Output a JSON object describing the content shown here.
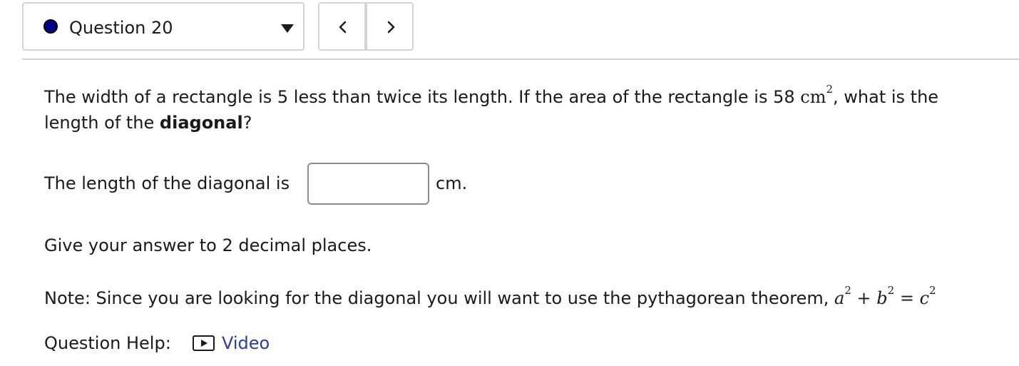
{
  "question_selector": {
    "label": "Question 20",
    "status_color": "#00008b"
  },
  "nav": {
    "prev_icon": "chevron-left-icon",
    "next_icon": "chevron-right-icon"
  },
  "question": {
    "text_part1": "The width of a rectangle is 5 less than twice its length. If the area of the rectangle is 58 ",
    "area_unit": "cm",
    "area_exponent": "2",
    "text_part2": ", what is the",
    "line2_prefix": "length of the ",
    "line2_bold": "diagonal",
    "line2_suffix": "?"
  },
  "answer": {
    "prompt": "The length of the diagonal is",
    "value": "",
    "units": "cm."
  },
  "instructions": "Give your answer to 2 decimal places.",
  "note": {
    "text": "Note: Since you are looking for the diagonal you will want to use the pythagorean theorem, ",
    "formula": {
      "a": "a",
      "b": "b",
      "c": "c",
      "exp": "2",
      "plus": "+",
      "equals": "="
    }
  },
  "help": {
    "label": "Question Help:",
    "link_label": "Video",
    "link_icon": "play-icon",
    "link_color": "#2f3a9e"
  }
}
